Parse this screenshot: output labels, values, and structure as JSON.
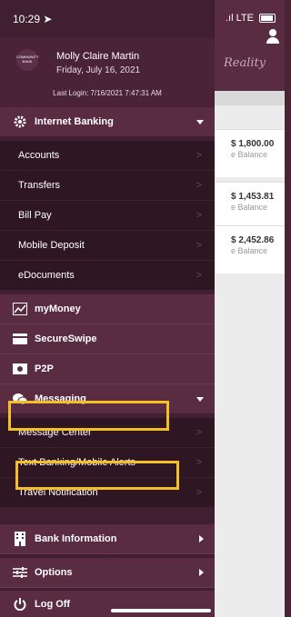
{
  "status": {
    "time": "10:29",
    "network": "LTE"
  },
  "profile": {
    "logo_text": "COMMUNITY BANK",
    "name": "Molly Claire Martin",
    "date": "Friday, July 16, 2021",
    "last_login": "Last Login: 7/16/2021 7:47:31 AM"
  },
  "background": {
    "header_script": "Reality",
    "cards": [
      {
        "amount": "$ 1,800.00",
        "label": "e Balance"
      },
      {
        "amount": "$ 1,453.81",
        "label": "e Balance"
      },
      {
        "amount": "$ 2,452.86",
        "label": "e Balance"
      }
    ]
  },
  "menu": {
    "internet_banking": "Internet Banking",
    "internet_items": [
      "Accounts",
      "Transfers",
      "Bill Pay",
      "Mobile Deposit",
      "eDocuments"
    ],
    "mymoney": "myMoney",
    "secureswipe": "SecureSwipe",
    "p2p": "P2P",
    "messaging": "Messaging",
    "messaging_items": [
      "Message Center",
      "Text Banking/Mobile Alerts",
      "Travel Notification"
    ],
    "bank_info": "Bank Information",
    "options": "Options",
    "logoff": "Log Off"
  },
  "colors": {
    "highlight": "#f4bf24",
    "drawer": "#3f1f30",
    "section": "#5a2c42"
  }
}
